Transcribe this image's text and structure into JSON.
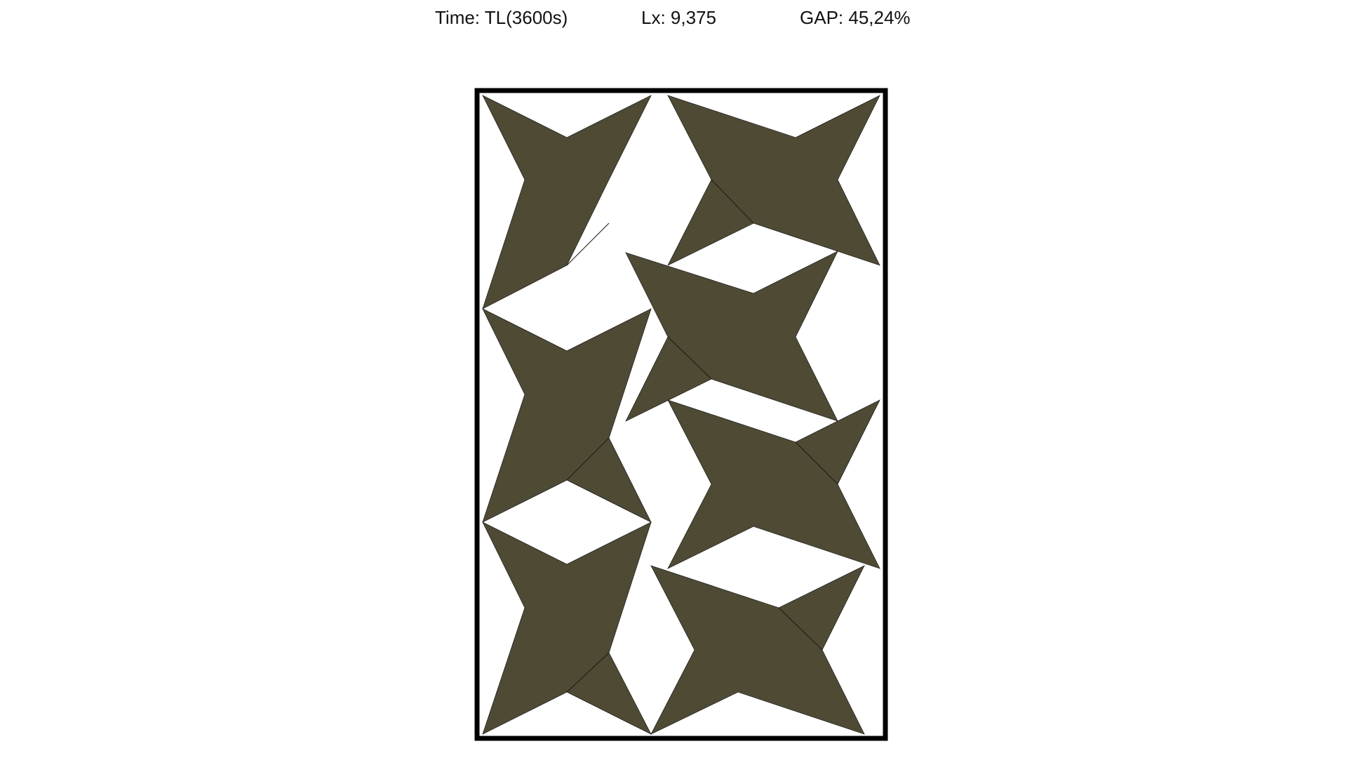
{
  "header": {
    "time_text": "Time: TL(3600s)",
    "lx_text": "Lx: 9,375",
    "gap_text": "GAP: 45,24%"
  },
  "colors": {
    "piece_fill": "#4f4a34",
    "container_stroke": "#000000",
    "background": "#ffffff"
  },
  "pieces": [
    {
      "name": "star-top-left"
    },
    {
      "name": "star-top-right"
    },
    {
      "name": "star-middle-right"
    },
    {
      "name": "star-middle-left"
    },
    {
      "name": "star-lower-right"
    },
    {
      "name": "star-bottom-left"
    },
    {
      "name": "star-bottom-right"
    }
  ]
}
